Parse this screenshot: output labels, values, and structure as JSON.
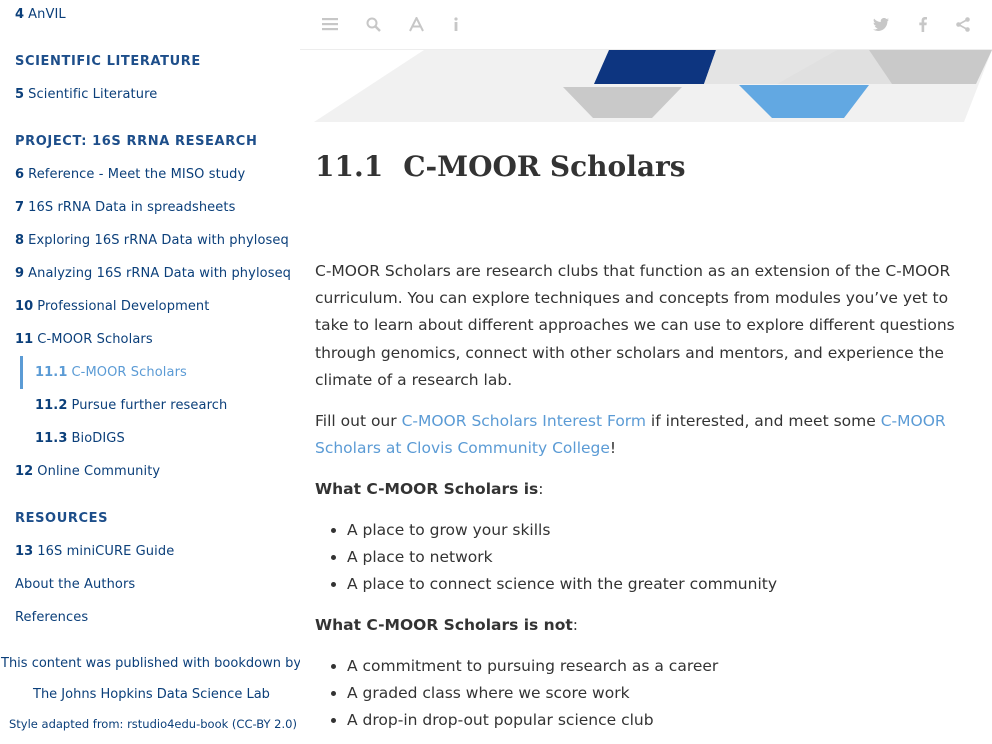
{
  "sidebar": {
    "items": [
      {
        "num": "4",
        "label": "AnVIL"
      },
      {
        "section": "SCIENTIFIC LITERATURE"
      },
      {
        "num": "5",
        "label": "Scientific Literature"
      },
      {
        "section": "PROJECT: 16S RRNA RESEARCH"
      },
      {
        "num": "6",
        "label": "Reference - Meet the MISO study"
      },
      {
        "num": "7",
        "label": "16S rRNA Data in spreadsheets"
      },
      {
        "num": "8",
        "label": "Exploring 16S rRNA Data with phyloseq"
      },
      {
        "num": "9",
        "label": "Analyzing 16S rRNA Data with phyloseq"
      },
      {
        "num": "10",
        "label": "Professional Development"
      },
      {
        "num": "11",
        "label": "C-MOOR Scholars"
      },
      {
        "num": "11.1",
        "label": "C-MOOR Scholars"
      },
      {
        "num": "11.2",
        "label": "Pursue further research"
      },
      {
        "num": "11.3",
        "label": "BioDIGS"
      },
      {
        "num": "12",
        "label": "Online Community"
      },
      {
        "section": "RESOURCES"
      },
      {
        "num": "13",
        "label": "16S miniCURE Guide"
      },
      {
        "label": "About the Authors"
      },
      {
        "label": "References"
      }
    ],
    "footer": {
      "published": "This content was published with bookdown by:",
      "lab": "The Johns Hopkins Data Science Lab",
      "style": "Style adapted from: rstudio4edu-book (CC-BY 2.0)"
    }
  },
  "toolbar": {
    "left_icons": [
      "menu-icon",
      "search-icon",
      "font-icon",
      "info-icon"
    ],
    "right_icons": [
      "twitter-icon",
      "facebook-icon",
      "share-icon"
    ]
  },
  "main": {
    "title_num": "11.1",
    "title": "C-MOOR Scholars",
    "intro": "C-MOOR Scholars are research clubs that function as an extension of the C-MOOR curriculum. You can explore techniques and concepts from modules you’ve yet to take to learn about different approaches we can use to explore different questions through genomics, connect with other scholars and mentors, and experience the climate of a research lab.",
    "fill_prefix": "Fill out our ",
    "fill_link1": "C-MOOR Scholars Interest Form",
    "fill_middle": " if interested, and meet some ",
    "fill_link2": "C-MOOR Scholars at Clovis Community College",
    "fill_suffix": "!",
    "is_heading": "What C-MOOR Scholars is",
    "is_heading_colon": ":",
    "is_items": [
      "A place to grow your skills",
      "A place to network",
      "A place to connect science with the greater community"
    ],
    "isnot_heading": "What C-MOOR Scholars is not",
    "isnot_heading_colon": ":",
    "isnot_items": [
      "A commitment to pursuing research as a career",
      "A graded class where we score work",
      "A drop-in drop-out popular science club"
    ]
  },
  "colors": {
    "navy": "#0b3f7a",
    "accent": "#5b9bd5",
    "banner_dark": "#0d3580",
    "banner_light": "#62a8e2",
    "banner_gray": "#c9c9c9",
    "banner_pale": "#ececec"
  }
}
